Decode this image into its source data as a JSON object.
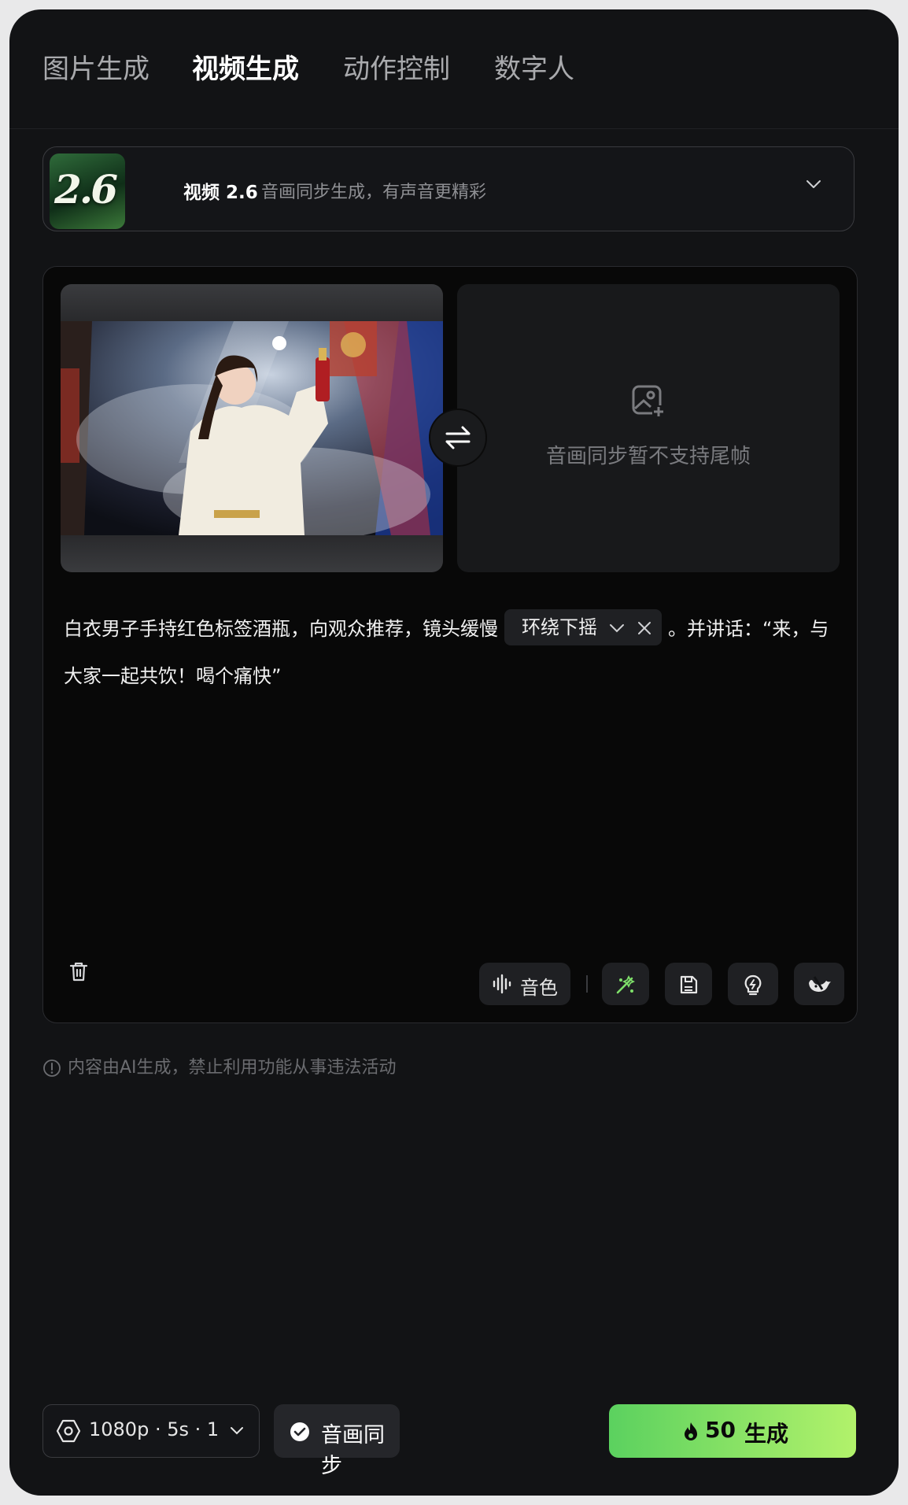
{
  "tabs": [
    {
      "label": "图片生成",
      "active": false
    },
    {
      "label": "视频生成",
      "active": true
    },
    {
      "label": "动作控制",
      "active": false
    },
    {
      "label": "数字人",
      "active": false
    }
  ],
  "model": {
    "badge": "2.6",
    "name": "视频 2.6",
    "description": "音画同步生成，有声音更精彩"
  },
  "frames": {
    "last_frame_message": "音画同步暂不支持尾帧"
  },
  "prompt": {
    "text_before": "白衣男子手持红色标签酒瓶，向观众推荐，镜头缓慢",
    "chip_label": "环绕下摇",
    "text_after": "。并讲话：“来，与大家一起共饮！喝个痛快”"
  },
  "toolbar": {
    "voice_label": "音色"
  },
  "notice": "内容由AI生成，禁止利用功能从事违法活动",
  "bottom": {
    "params_label": "1080p · 5s · 1",
    "sync_label": "音画同步",
    "generate_cost": "50",
    "generate_label": "生成"
  },
  "colors": {
    "background": "#121315",
    "accent_start": "#5bd15f",
    "accent_end": "#b2f26b"
  }
}
